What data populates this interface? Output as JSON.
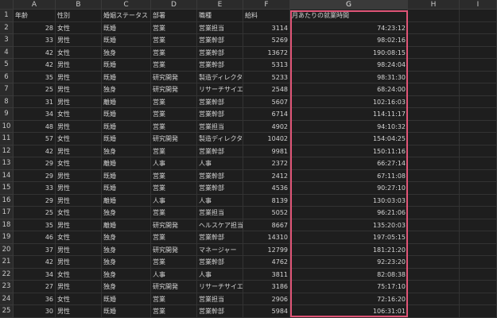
{
  "columns": [
    "A",
    "B",
    "C",
    "D",
    "E",
    "F",
    "G",
    "H",
    "I"
  ],
  "header": [
    "年齢",
    "性別",
    "婚姻ステータス",
    "部署",
    "職種",
    "給料",
    "月あたりの就業時間",
    "",
    ""
  ],
  "rows": [
    [
      "28",
      "女性",
      "既婚",
      "営業",
      "営業担当",
      "3114",
      "74:23:12"
    ],
    [
      "33",
      "男性",
      "既婚",
      "営業",
      "営業幹部",
      "5269",
      "98:02:16"
    ],
    [
      "42",
      "女性",
      "独身",
      "営業",
      "営業幹部",
      "13672",
      "190:08:15"
    ],
    [
      "42",
      "男性",
      "既婚",
      "営業",
      "営業幹部",
      "5313",
      "98:24:04"
    ],
    [
      "35",
      "男性",
      "既婚",
      "研究開発",
      "製造ディレクター",
      "5233",
      "98:31:30"
    ],
    [
      "25",
      "男性",
      "独身",
      "研究開発",
      "リサーチサイエンティスト",
      "2548",
      "68:24:00"
    ],
    [
      "31",
      "男性",
      "離婚",
      "営業",
      "営業幹部",
      "5607",
      "102:16:03"
    ],
    [
      "34",
      "女性",
      "既婚",
      "営業",
      "営業幹部",
      "6714",
      "114:11:17"
    ],
    [
      "48",
      "男性",
      "既婚",
      "営業",
      "営業担当",
      "4902",
      "94:10:32"
    ],
    [
      "57",
      "女性",
      "既婚",
      "研究開発",
      "製造ディレクター",
      "10402",
      "154:04:25"
    ],
    [
      "42",
      "男性",
      "独身",
      "営業",
      "営業幹部",
      "9981",
      "150:11:16"
    ],
    [
      "29",
      "女性",
      "離婚",
      "人事",
      "人事",
      "2372",
      "66:27:14"
    ],
    [
      "29",
      "男性",
      "既婚",
      "営業",
      "営業幹部",
      "2412",
      "67:11:08"
    ],
    [
      "33",
      "男性",
      "既婚",
      "営業",
      "営業幹部",
      "4536",
      "90:27:10"
    ],
    [
      "29",
      "男性",
      "離婚",
      "人事",
      "人事",
      "8139",
      "130:03:03"
    ],
    [
      "25",
      "女性",
      "独身",
      "営業",
      "営業担当",
      "5052",
      "96:21:06"
    ],
    [
      "35",
      "男性",
      "離婚",
      "研究開発",
      "ヘルスケア担当",
      "8667",
      "135:20:03"
    ],
    [
      "46",
      "女性",
      "独身",
      "営業",
      "営業幹部",
      "14310",
      "197:05:15"
    ],
    [
      "37",
      "男性",
      "独身",
      "研究開発",
      "マネージャー",
      "12799",
      "181:21:20"
    ],
    [
      "42",
      "男性",
      "独身",
      "営業",
      "営業幹部",
      "4762",
      "92:23:20"
    ],
    [
      "34",
      "女性",
      "独身",
      "人事",
      "人事",
      "3811",
      "82:08:38"
    ],
    [
      "27",
      "男性",
      "独身",
      "研究開発",
      "リサーチサイエンティスト",
      "3186",
      "75:17:10"
    ],
    [
      "36",
      "女性",
      "既婚",
      "営業",
      "営業担当",
      "2906",
      "72:16:20"
    ],
    [
      "30",
      "男性",
      "既婚",
      "営業",
      "営業幹部",
      "5984",
      "106:31:01"
    ]
  ]
}
